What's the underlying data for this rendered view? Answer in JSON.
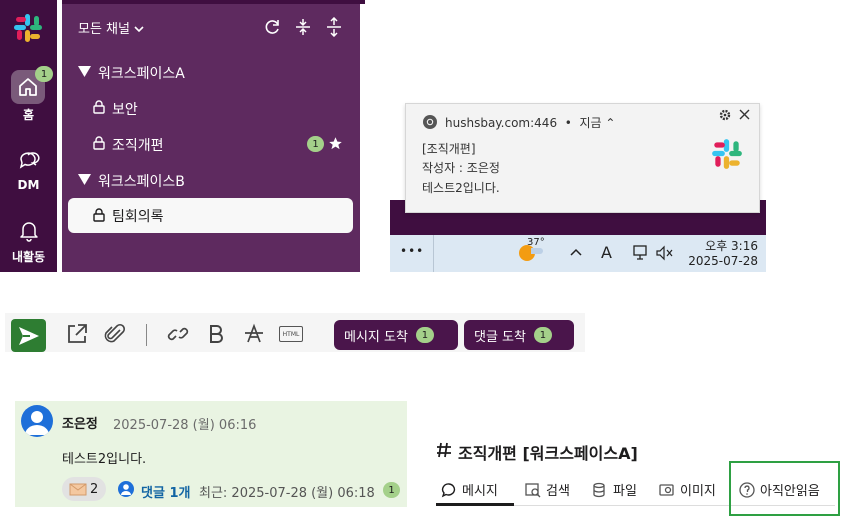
{
  "sidebar": {
    "rail": {
      "home_label": "홈",
      "home_badge": "1",
      "dm_label": "DM",
      "activity_label": "내활동"
    },
    "header_title": "모든 채널",
    "workspaces": [
      {
        "name": "워크스페이스A",
        "channels": [
          {
            "name": "보안"
          },
          {
            "name": "조직개편",
            "badge": "1"
          }
        ]
      },
      {
        "name": "워크스페이스B",
        "channels": [
          {
            "name": "팀회의록"
          }
        ]
      }
    ]
  },
  "notification": {
    "source": "hushsbay.com:446",
    "time": "지금",
    "line1": "[조직개편]",
    "line2": "작성자 : 조은정",
    "line3": "테스트2입니다.",
    "weather_temp": "37°",
    "clock_time": "오후 3:16",
    "clock_date": "2025-07-28",
    "ime_label": "A",
    "more_label": "•••"
  },
  "toolbar": {
    "html_label": "HTML",
    "message_arrival_label": "메시지 도착",
    "message_arrival_count": "1",
    "reply_arrival_label": "댓글 도착",
    "reply_arrival_count": "1"
  },
  "message": {
    "author": "조은정",
    "timestamp": "2025-07-28 (월) 06:16",
    "text": "테스트2입니다.",
    "reaction_count": "2",
    "reply_label": "댓글 1개",
    "latest_label": "최근: 2025-07-28 (월) 06:18",
    "latest_badge": "1"
  },
  "channel_view": {
    "title": "조직개편 [워크스페이스A]",
    "tabs": [
      "메시지",
      "검색",
      "파일",
      "이미지",
      "아직안읽음"
    ]
  },
  "colors": {
    "aubergine": "#3f0e40",
    "sidebar": "#5e2a5f",
    "badge_green": "#a4d08a",
    "send_green": "#2e7d32",
    "highlight_green": "#2ea043"
  }
}
